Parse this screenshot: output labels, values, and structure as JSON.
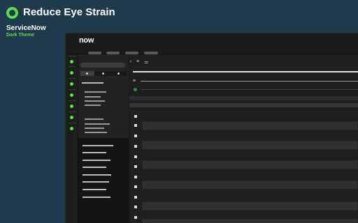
{
  "promo": {
    "headline": "Reduce Eye Strain",
    "brand": "ServiceNow",
    "subtitle": "Dark Theme",
    "accent_color": "#62d84e",
    "background_color": "#1f3a4c"
  },
  "app": {
    "logo_text": "now",
    "top_nav": [
      "",
      "",
      "",
      ""
    ],
    "rail_icons": [
      "dot-icon",
      "dot-icon",
      "dot-icon",
      "dot-icon",
      "dot-icon",
      "dot-icon",
      "dot-icon"
    ],
    "toolbar_icons": [
      "chevron-left-icon",
      "hamburger-icon",
      "filter-icon"
    ]
  }
}
